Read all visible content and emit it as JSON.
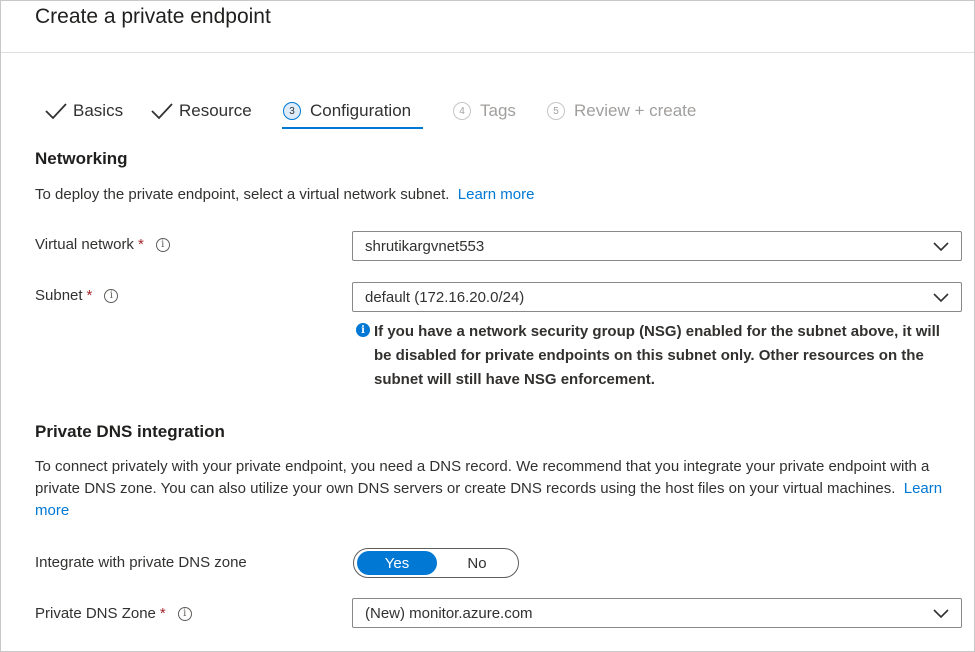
{
  "page": {
    "title": "Create a private endpoint"
  },
  "tabs": [
    {
      "label": "Basics",
      "state": "completed",
      "icon": "checkmark-icon"
    },
    {
      "label": "Resource",
      "state": "completed",
      "icon": "checkmark-icon"
    },
    {
      "label": "Configuration",
      "number": "3",
      "state": "active"
    },
    {
      "label": "Tags",
      "number": "4",
      "state": "disabled"
    },
    {
      "label": "Review + create",
      "number": "5",
      "state": "disabled"
    }
  ],
  "networking": {
    "title": "Networking",
    "description": "To deploy the private endpoint, select a virtual network subnet.",
    "learn_more": "Learn more",
    "virtual_network": {
      "label": "Virtual network",
      "required": "*",
      "value": "shrutikargvnet553"
    },
    "subnet": {
      "label": "Subnet",
      "required": "*",
      "value": "default (172.16.20.0/24)"
    },
    "notice": {
      "icon": "i",
      "text": "If you have a network security group (NSG) enabled for the subnet above, it will be disabled for private endpoints on this subnet only. Other resources on the subnet will still have NSG enforcement."
    }
  },
  "dns": {
    "title": "Private DNS integration",
    "description": "To connect privately with your private endpoint, you need a DNS record. We recommend that you integrate your private endpoint with a private DNS zone. You can also utilize your own DNS servers or create DNS records using the host files on your virtual machines.",
    "learn_more": "Learn more",
    "integrate": {
      "label": "Integrate with private DNS zone",
      "yes": "Yes",
      "no": "No",
      "selected": "Yes"
    },
    "zone": {
      "label": "Private DNS Zone",
      "required": "*",
      "value": "(New) monitor.azure.com"
    }
  },
  "info_glyph": "i",
  "colors": {
    "accent": "#0078d4",
    "required": "#a4262c",
    "text": "#323130",
    "disabled": "#a19f9d"
  }
}
